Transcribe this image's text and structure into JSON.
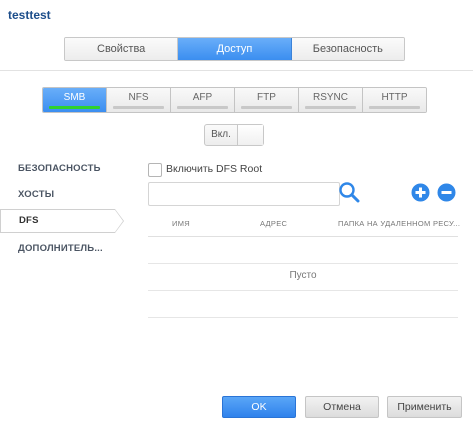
{
  "app": {
    "title": "testtest"
  },
  "main_tabs": [
    {
      "label": "Свойства",
      "active": false
    },
    {
      "label": "Доступ",
      "active": true
    },
    {
      "label": "Безопасность",
      "active": false
    }
  ],
  "protocol_tabs": [
    {
      "label": "SMB",
      "active": true
    },
    {
      "label": "NFS",
      "active": false
    },
    {
      "label": "AFP",
      "active": false
    },
    {
      "label": "FTP",
      "active": false
    },
    {
      "label": "RSYNC",
      "active": false
    },
    {
      "label": "HTTP",
      "active": false
    }
  ],
  "toggle": {
    "label": "Вкл."
  },
  "sidebar": {
    "items": [
      {
        "label": "БЕЗОПАСНОСТЬ",
        "active": false
      },
      {
        "label": "ХОСТЫ",
        "active": false
      },
      {
        "label": "DFS",
        "active": true
      },
      {
        "label": "ДОПОЛНИТЕЛЬ...",
        "active": false
      }
    ]
  },
  "dfs": {
    "enable_label": "Включить DFS Root",
    "search_placeholder": "",
    "columns": [
      "ИМЯ",
      "АДРЕС",
      "ПАПКА НА УДАЛЕННОМ РЕСУ..."
    ],
    "empty_text": "Пусто"
  },
  "buttons": {
    "ok": "OK",
    "cancel": "Отмена",
    "apply": "Применить"
  },
  "colors": {
    "accent": "#3b8ef0",
    "active_indicator": "#2fd12f",
    "title": "#1c4d8a",
    "icon_blue": "#2f87e8"
  }
}
